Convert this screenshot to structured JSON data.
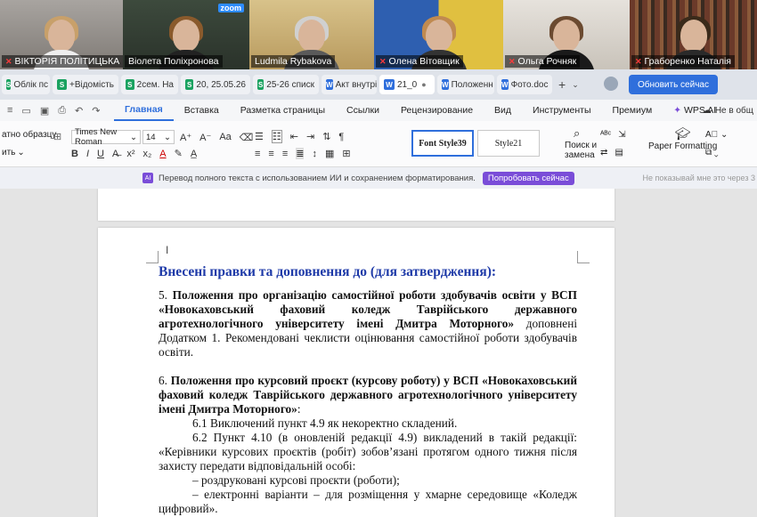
{
  "participants": [
    {
      "name": "ВІКТОРІЯ ПОЛІТИЦЬКА",
      "muted": true
    },
    {
      "name": "Віолета Поліхронова",
      "muted": false,
      "active": true
    },
    {
      "name": "Ludmila Rybakova",
      "muted": false
    },
    {
      "name": "Олена Вітовщик",
      "muted": true
    },
    {
      "name": "Ольга Рочняк",
      "muted": true
    },
    {
      "name": "Граборенко Наталія",
      "muted": true
    }
  ],
  "zoom_label": "zoom",
  "tabs": [
    {
      "label": "Облік пс",
      "icon": "S"
    },
    {
      "label": "+Відомість",
      "icon": "S"
    },
    {
      "label": "2сем. На",
      "icon": "S"
    },
    {
      "label": "20, 25.05.26",
      "icon": "S"
    },
    {
      "label": "25-26 списк",
      "icon": "S"
    },
    {
      "label": "Акт внутрі",
      "icon": "W"
    },
    {
      "label": "21_0",
      "icon": "W",
      "active": true
    },
    {
      "label": "Положенн",
      "icon": "W"
    },
    {
      "label": "Фото.doc",
      "icon": "W"
    }
  ],
  "update_button": "Обновить сейчас",
  "menu": [
    "Главная",
    "Вставка",
    "Разметка страницы",
    "Ссылки",
    "Рецензирование",
    "Вид",
    "Инструменты",
    "Премиум",
    "WPS AI"
  ],
  "menu_active": "Главная",
  "menu_right": "Не в общ",
  "toolbar": {
    "format_painter": "атно образцу",
    "clear_label": "ить",
    "font": "Times New Roman",
    "size": "14",
    "style1": "Font Style39",
    "style2": "Style21",
    "find_label": "Поиск и",
    "replace_label": "замена",
    "paper_label": "Paper Formatting"
  },
  "banner": {
    "text": "Перевод полного текста с использованием ИИ и сохранением форматирования.",
    "button": "Попробовать сейчас",
    "dismiss": "Не показывай мне это через 3"
  },
  "document": {
    "heading": "Внесені правки та доповнення до (для затвердження):",
    "item5_num": "5.",
    "item5_bold": "Положення про організацію самостійної роботи здобувачів освіти у ВСП «Новокаховський фаховий коледж Таврійського державного агротехнологічного університету імені Дмитра Моторного»",
    "item5_rest": " доповнені Додатком 1. Рекомендовані чеклисти оцінювання самостійної роботи здобувачів освіти.",
    "item6_num": "6.",
    "item6_bold": "Положення про курсовий проєкт (курсову роботу) у ВСП «Новокаховський фаховий коледж Таврійського державного агротехнологічного університету імені Дмитра Моторного»",
    "item6_rest": ":",
    "p61": "6.1 Виключений пункт 4.9 як некоректно складений.",
    "p62": "6.2 Пункт 4.10 (в оновленій редакції 4.9) викладений в такій редакції: «Керівники курсових проєктів (робіт) зобов’язані протягом одного тижня після захисту передати відповідальній особі:",
    "b1": "–  роздруковані курсові проєкти (роботи);",
    "b2": "–  електронні варіанти – для розміщення у хмарне середовище «Коледж цифровий»."
  }
}
